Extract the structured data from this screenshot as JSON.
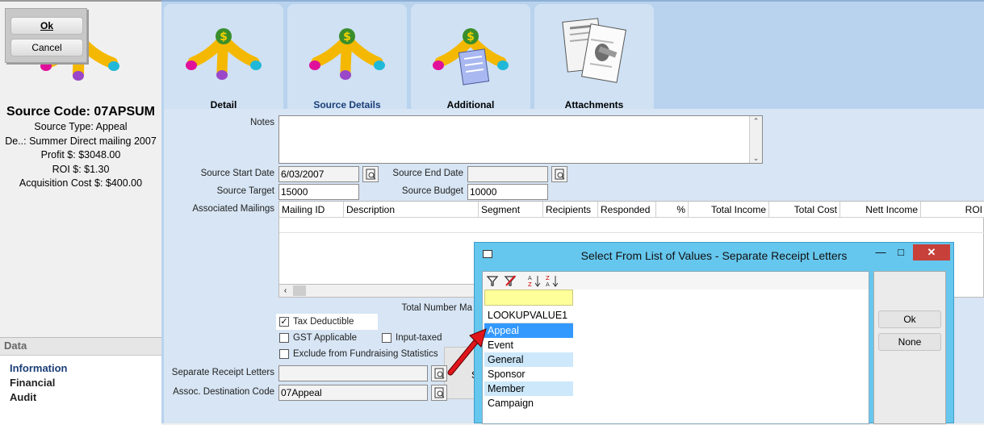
{
  "dialog_buttons": {
    "ok": "Ok",
    "cancel": "Cancel"
  },
  "summary": {
    "title": "Source Code: 07APSUM",
    "lines": [
      "Source Type: Appeal",
      "De..: Summer Direct mailing 2007",
      "Profit $: $3048.00",
      "ROI $: $1.30",
      "Acquisition Cost $: $400.00"
    ]
  },
  "data_panel": {
    "header": "Data",
    "items": [
      "Information",
      "Financial",
      "Audit"
    ]
  },
  "tabs": [
    {
      "label": "Detail",
      "icon": "money-hand-icon"
    },
    {
      "label": "Source Details",
      "icon": "money-hand-icon",
      "active": true
    },
    {
      "label": "Additional",
      "icon": "money-hand-notepad-icon"
    },
    {
      "label": "Attachments",
      "icon": "paperclip-documents-icon"
    }
  ],
  "form": {
    "notes_label": "Notes",
    "notes_value": "",
    "source_start_date_label": "Source Start Date",
    "source_start_date": "6/03/2007",
    "source_end_date_label": "Source End Date",
    "source_end_date": "",
    "source_target_label": "Source Target",
    "source_target": "15000",
    "source_budget_label": "Source Budget",
    "source_budget": "10000",
    "associated_mailings_label": "Associated Mailings",
    "total_number_label": "Total Number Ma",
    "tax_deductible": "Tax Deductible",
    "gst_applicable": "GST Applicable",
    "input_taxed": "Input-taxed",
    "exclude_fundraising": "Exclude from Fundraising Statistics",
    "separate_receipt_letters_label": "Separate Receipt Letters",
    "separate_receipt_letters": "",
    "assoc_destination_code_label": "Assoc. Destination Code",
    "assoc_destination_code": "07Appeal",
    "partial_button_1": "S",
    "partial_button_2": ""
  },
  "mailings_grid": {
    "columns": [
      "Mailing ID",
      "Description",
      "Segment",
      "Recipients",
      "Responded",
      "%",
      "Total Income",
      "Total Cost",
      "Nett Income",
      "ROI"
    ],
    "rows": []
  },
  "lov_dialog": {
    "title": "Select From List of Values - Separate Receipt Letters",
    "column_header": "LOOKUPVALUE1",
    "filter_value": "",
    "items": [
      "Appeal",
      "Event",
      "General",
      "Sponsor",
      "Member",
      "Campaign"
    ],
    "selected_index": 0,
    "ok": "Ok",
    "none": "None"
  },
  "colors": {
    "tab_bg": "#cfe1f3",
    "content_bg": "#d7e5f4",
    "dialog_frame": "#66c7ee",
    "selected_row": "#3399ff",
    "alt_row": "#cde8fb",
    "arrow": "#e0161c",
    "close_button": "#c7403a"
  }
}
